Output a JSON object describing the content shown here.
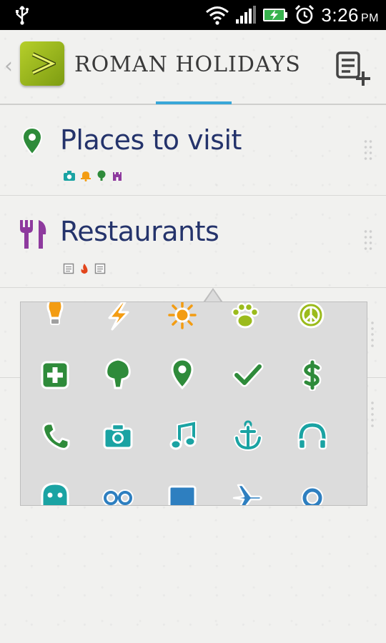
{
  "status_bar": {
    "time": "3:26",
    "ampm": "PM",
    "icons": [
      "usb-icon",
      "wifi-icon",
      "signal-icon",
      "battery-charging-icon",
      "alarm-icon"
    ]
  },
  "action_bar": {
    "title": "ROMAN HOLIDAYS",
    "app_icon": "app-logo-icon",
    "back_icon": "chevron-left-icon",
    "add_list_icon": "add-list-icon",
    "accent_color": "#39a7d8"
  },
  "lists": [
    {
      "title": "Places to visit",
      "icon": "location-pin-icon",
      "icon_color": "#2e8b3a",
      "tags": [
        {
          "icon": "camera-icon",
          "color": "#1aa3a3"
        },
        {
          "icon": "bell-icon",
          "color": "#f39c12"
        },
        {
          "icon": "tree-icon",
          "color": "#2e8b3a"
        },
        {
          "icon": "castle-icon",
          "color": "#8e3a9e"
        }
      ]
    },
    {
      "title": "Restaurants",
      "icon": "fork-knife-icon",
      "icon_color": "#8e3a9e",
      "tags": [
        {
          "icon": "note-icon",
          "color": "#8a8a8a"
        },
        {
          "icon": "fire-icon",
          "color": "#e2451c"
        },
        {
          "icon": "note-icon",
          "color": "#8a8a8a"
        }
      ]
    }
  ],
  "icon_picker": {
    "rows": [
      [
        {
          "icon": "lightbulb-icon",
          "color": "#f39c12"
        },
        {
          "icon": "lightning-icon",
          "color": "#f39c12"
        },
        {
          "icon": "sun-icon",
          "color": "#f39c12"
        },
        {
          "icon": "paw-icon",
          "color": "#9bbb1c"
        },
        {
          "icon": "peace-icon",
          "color": "#9bbb1c"
        }
      ],
      [
        {
          "icon": "first-aid-icon",
          "color": "#2e8b3a"
        },
        {
          "icon": "tree-icon",
          "color": "#2e8b3a"
        },
        {
          "icon": "location-pin-icon",
          "color": "#2e8b3a"
        },
        {
          "icon": "checkmark-icon",
          "color": "#2e8b3a"
        },
        {
          "icon": "dollar-icon",
          "color": "#2e8b3a"
        }
      ],
      [
        {
          "icon": "phone-icon",
          "color": "#1aa3a3"
        },
        {
          "icon": "camera-icon",
          "color": "#1aa3a3"
        },
        {
          "icon": "music-note-icon",
          "color": "#1aa3a3"
        },
        {
          "icon": "anchor-icon",
          "color": "#1aa3a3"
        },
        {
          "icon": "headphones-icon",
          "color": "#1aa3a3"
        }
      ],
      [
        {
          "icon": "ghost-icon",
          "color": "#1aa3a3"
        },
        {
          "icon": "glasses-icon",
          "color": "#2e7fc0"
        },
        {
          "icon": "screen-icon",
          "color": "#2e7fc0"
        },
        {
          "icon": "airplane-icon",
          "color": "#2e7fc0"
        },
        {
          "icon": "ring-icon",
          "color": "#2e7fc0"
        }
      ]
    ]
  }
}
